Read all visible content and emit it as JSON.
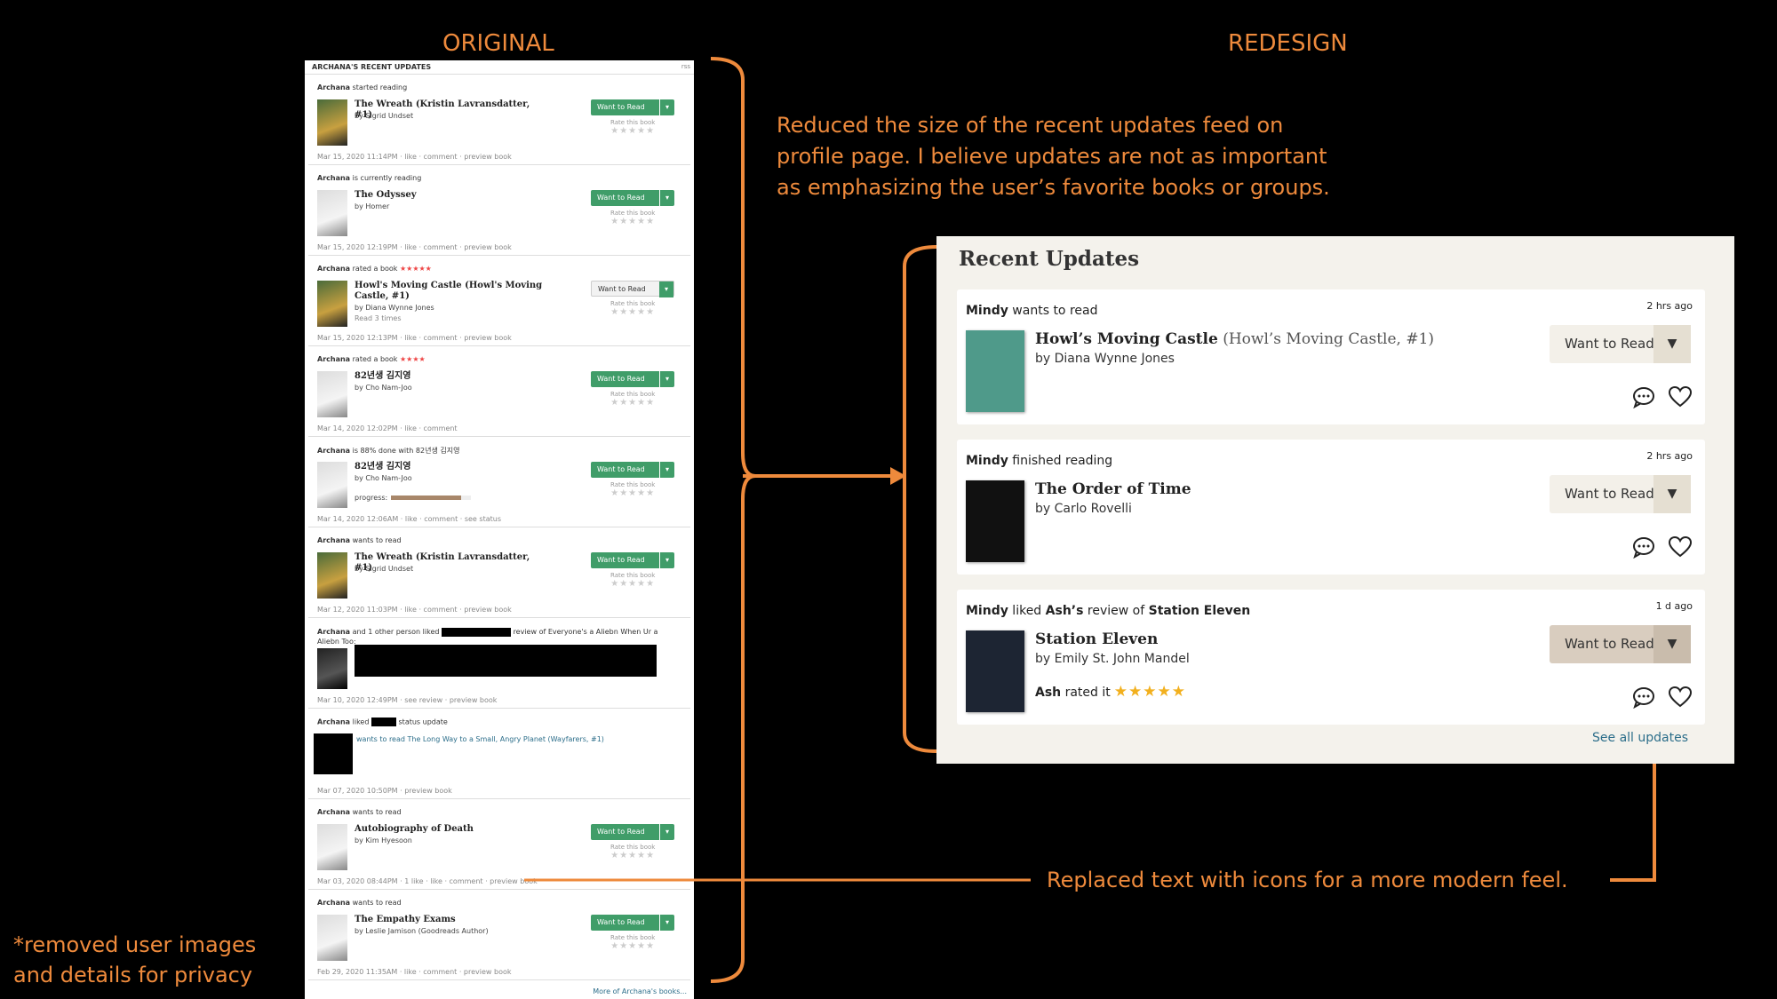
{
  "headings": {
    "original": "ORIGINAL",
    "redesign": "REDESIGN"
  },
  "notes": {
    "size_note_1": "Reduced the size of the recent updates feed on",
    "size_note_2": "profile page. I believe updates are not as important",
    "size_note_3": "as emphasizing the user’s favorite books or groups.",
    "icons_note": "Replaced text with icons for a more modern feel.",
    "privacy_note_1": "*removed user images",
    "privacy_note_2": "and details for privacy"
  },
  "original": {
    "header": "ARCHANA'S RECENT UPDATES",
    "rss": "rss",
    "want_label": "Want to Read",
    "rate_label": "Rate this book",
    "stars_empty": "★★★★★",
    "items": [
      {
        "user": "Archana",
        "action": " started reading",
        "title": "The Wreath (Kristin Lavransdatter, #1)",
        "by": "by Sigrid Undset",
        "meta": "Mar 15, 2020 11:14PM · like · comment · preview book"
      },
      {
        "user": "Archana",
        "action": " is currently reading",
        "title": "The Odyssey",
        "by": "by Homer",
        "meta": "Mar 15, 2020 12:19PM · like · comment · preview book"
      },
      {
        "user": "Archana",
        "action": " rated a book ",
        "stars": "★★★★★",
        "title": "Howl's Moving Castle (Howl's Moving Castle, #1)",
        "by": "by Diana Wynne Jones",
        "extra": "Read 3 times",
        "meta": "Mar 15, 2020 12:13PM · like · comment · preview book"
      },
      {
        "user": "Archana",
        "action": " rated a book ",
        "stars": "★★★★",
        "title": "82년생 김지영",
        "by": "by Cho Nam-Joo",
        "meta": "Mar 14, 2020 12:02PM · like · comment"
      },
      {
        "user": "Archana",
        "action": " is 88% done with 82년생 김지영",
        "title": "82년생 김지영",
        "by": "by Cho Nam-Joo",
        "progress_label": "progress:",
        "progress": 0.88,
        "meta": "Mar 14, 2020 12:06AM · like · comment · see status"
      },
      {
        "user": "Archana",
        "action": " wants to read",
        "title": "The Wreath (Kristin Lavransdatter, #1)",
        "by": "by Sigrid Undset",
        "meta": "Mar 12, 2020 11:03PM · like · comment · preview book"
      },
      {
        "user": "Archana",
        "action": " and 1 other person liked",
        "action2": "review of Everyone's a Aliebn When Ur a Aliebn Too:",
        "meta": "Mar 10, 2020 12:49PM · see review · preview book"
      },
      {
        "user": "Archana",
        "action": " liked",
        "action2": "status update",
        "sub": "wants to read The Long Way to a Small, Angry Planet (Wayfarers, #1)",
        "meta": "Mar 07, 2020 10:50PM · preview book"
      },
      {
        "user": "Archana",
        "action": " wants to read",
        "title": "Autobiography of Death",
        "by": "by Kim Hyesoon",
        "meta": "Mar 03, 2020 08:44PM · 1 like · like · comment · preview book"
      },
      {
        "user": "Archana",
        "action": " wants to read",
        "title": "The Empathy Exams",
        "by": "by Leslie Jamison (Goodreads Author)",
        "meta": "Feb 29, 2020 11:35AM · like · comment · preview book"
      }
    ],
    "more_link": "More of Archana's books..."
  },
  "redesign": {
    "title": "Recent Updates",
    "want_label": "Want to Read",
    "see_all": "See all updates",
    "cards": [
      {
        "user": "Mindy",
        "action": " wants to read",
        "time": "2 hrs ago",
        "title": "Howl’s Moving Castle",
        "series": " (Howl’s Moving Castle, #1)",
        "author": "by Diana Wynne Jones",
        "cover_color": "#4f9a8a"
      },
      {
        "user": "Mindy",
        "action": " finished reading",
        "time": "2 hrs ago",
        "title": "The Order of Time",
        "author": "by Carlo Rovelli",
        "cover_color": "#111111"
      },
      {
        "user": "Mindy",
        "action": " liked ",
        "user2": "Ash’s",
        "action2": " review of ",
        "book_ref": "Station Eleven",
        "time": "1 d ago",
        "title": "Station Eleven",
        "author": "by Emily St. John Mandel",
        "rater": "Ash",
        "rated_text": " rated it",
        "rating_stars": "★★★★★",
        "rating": 5,
        "cover_color": "#1d2533"
      }
    ]
  }
}
